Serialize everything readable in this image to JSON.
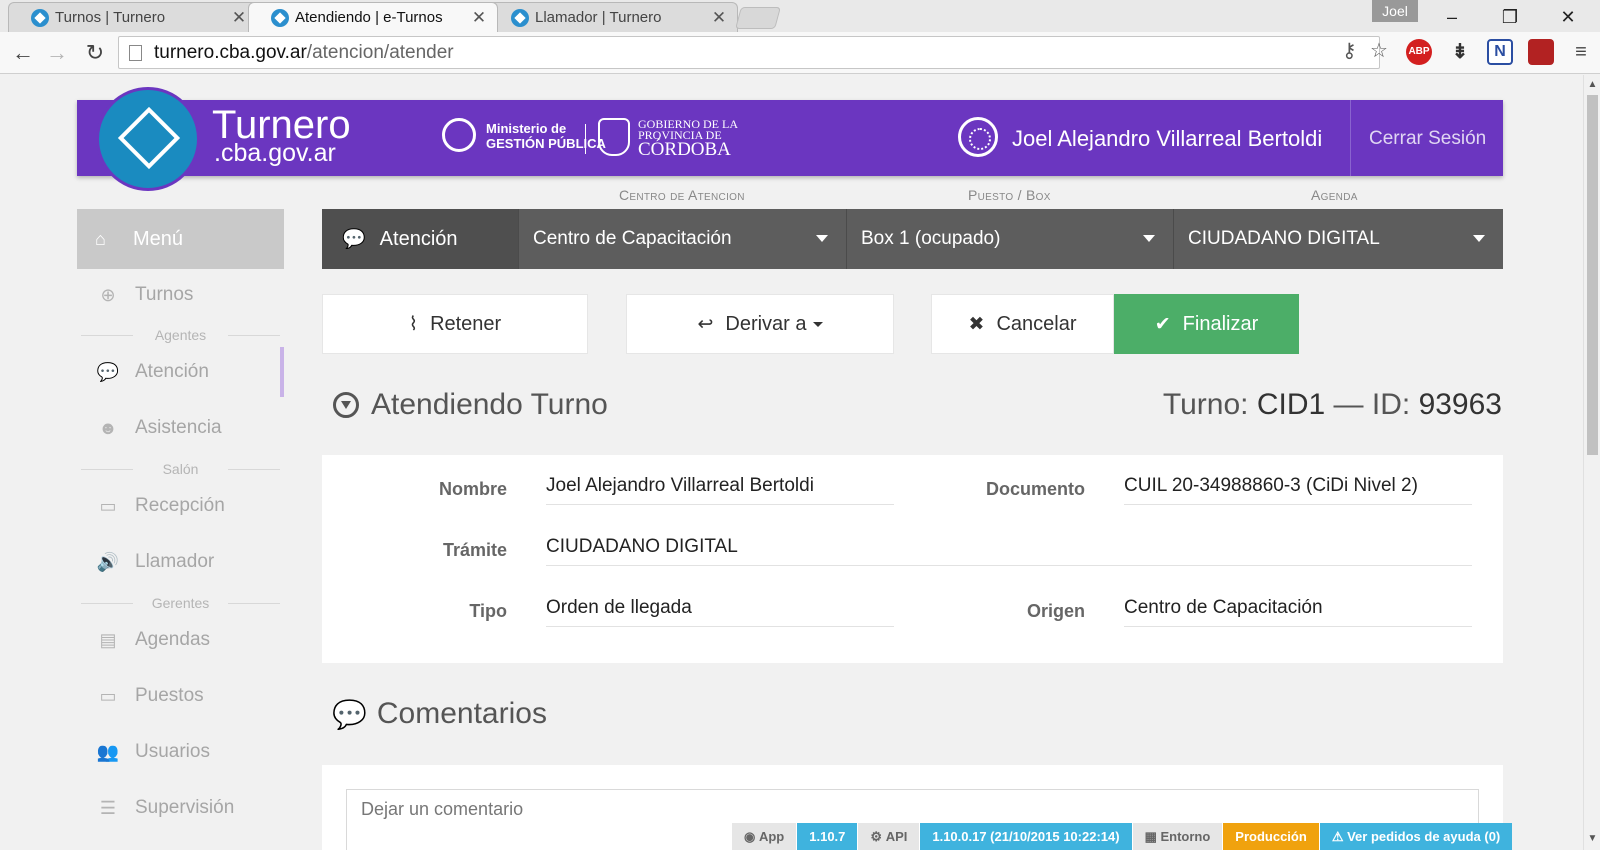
{
  "browser": {
    "tabs": [
      {
        "label": "Turnos | Turnero",
        "close": "✕"
      },
      {
        "label": "Atendiendo | e-Turnos",
        "close": "✕"
      },
      {
        "label": "Llamador | Turnero",
        "close": "✕"
      }
    ],
    "profile": "Joel",
    "url_host": "turnero.cba.gov.ar",
    "url_path": "/atencion/atender",
    "extensions": [
      {
        "name": "adblock",
        "label": "ABP",
        "color": "#d31f1f"
      },
      {
        "name": "extension-2",
        "label": "",
        "color": "#333333"
      },
      {
        "name": "extension-n",
        "label": "N",
        "color": "#2b4ea2"
      },
      {
        "name": "pdf",
        "label": "",
        "color": "#b22222"
      }
    ]
  },
  "header": {
    "brand_top": "Turnero",
    "brand_bottom": ".cba.gov.ar",
    "ministry_line1": "Ministerio de",
    "ministry_line2": "GESTIÓN PÚBLICA",
    "gob_line1": "GOBIERNO DE LA",
    "gob_line2": "PROVINCIA DE",
    "gob_line3": "CÓRDOBA",
    "user_name": "Joel Alejandro Villarreal Bertoldi",
    "logout": "Cerrar Sesión"
  },
  "sidebar": {
    "menu": "Menú",
    "items": {
      "turnos": "Turnos",
      "atencion": "Atención",
      "asistencia": "Asistencia",
      "recepcion": "Recepción",
      "llamador": "Llamador",
      "agendas": "Agendas",
      "puestos": "Puestos",
      "usuarios": "Usuarios",
      "supervision": "Supervisión"
    },
    "groups": {
      "agentes": "Agentes",
      "salon": "Salón",
      "gerentes": "Gerentes"
    }
  },
  "selectors": {
    "label_centro": "Centro de Atencion",
    "label_puesto": "Puesto / Box",
    "label_agenda": "Agenda",
    "atencion": "Atención",
    "centro": "Centro de Capacitación",
    "puesto": "Box 1 (ocupado)",
    "agenda": "CIUDADANO DIGITAL"
  },
  "actions": {
    "retener": "Retener",
    "derivar": "Derivar a",
    "cancelar": "Cancelar",
    "finalizar": "Finalizar"
  },
  "turno": {
    "title": "Atendiendo Turno",
    "prefix": "Turno:",
    "code": "CID1",
    "sep": "— ID:",
    "id": "93963"
  },
  "details": {
    "nombre_label": "Nombre",
    "nombre": "Joel Alejandro Villarreal Bertoldi",
    "documento_label": "Documento",
    "documento": "CUIL 20-34988860-3 (CiDi Nivel 2)",
    "tramite_label": "Trámite",
    "tramite": "CIUDADANO DIGITAL",
    "tipo_label": "Tipo",
    "tipo": "Orden de llegada",
    "origen_label": "Origen",
    "origen": "Centro de Capacitación"
  },
  "comments": {
    "title": "Comentarios",
    "placeholder": "Dejar un comentario"
  },
  "status": {
    "app_label": "App",
    "app_version": "1.10.7",
    "api_label": "API",
    "api_version": "1.10.0.17 (21/10/2015 10:22:14)",
    "env_label": "Entorno",
    "env_value": "Producción",
    "help": "Ver pedidos de ayuda (0)"
  },
  "colors": {
    "header_purple": "#6b36c0",
    "logo_blue": "#1a8bc0",
    "finalize_green": "#4cae68",
    "status_blue": "#3fb3de",
    "status_orange": "#f0a20e"
  }
}
